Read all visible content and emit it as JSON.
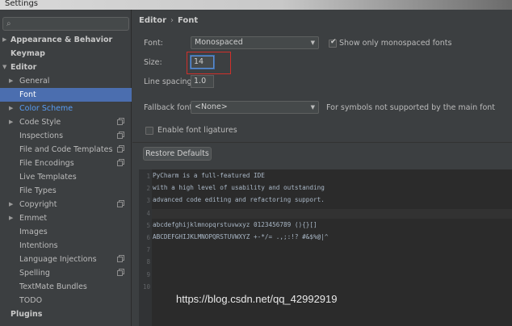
{
  "window": {
    "title": "Settings"
  },
  "sidebar": {
    "items": [
      {
        "label": "Appearance & Behavior",
        "level": 0,
        "arrow": "▶",
        "bold": true
      },
      {
        "label": "Keymap",
        "level": 0,
        "arrow": "",
        "bold": true
      },
      {
        "label": "Editor",
        "level": 0,
        "arrow": "▼",
        "bold": true
      },
      {
        "label": "General",
        "level": 1,
        "arrow": "▶"
      },
      {
        "label": "Font",
        "level": 1,
        "arrow": "",
        "selected": true
      },
      {
        "label": "Color Scheme",
        "level": 1,
        "arrow": "▶",
        "link": true
      },
      {
        "label": "Code Style",
        "level": 1,
        "arrow": "▶",
        "copy": true
      },
      {
        "label": "Inspections",
        "level": 1,
        "arrow": "",
        "copy": true
      },
      {
        "label": "File and Code Templates",
        "level": 1,
        "arrow": "",
        "copy": true
      },
      {
        "label": "File Encodings",
        "level": 1,
        "arrow": "",
        "copy": true
      },
      {
        "label": "Live Templates",
        "level": 1,
        "arrow": ""
      },
      {
        "label": "File Types",
        "level": 1,
        "arrow": ""
      },
      {
        "label": "Copyright",
        "level": 1,
        "arrow": "▶",
        "copy": true
      },
      {
        "label": "Emmet",
        "level": 1,
        "arrow": "▶"
      },
      {
        "label": "Images",
        "level": 1,
        "arrow": ""
      },
      {
        "label": "Intentions",
        "level": 1,
        "arrow": ""
      },
      {
        "label": "Language Injections",
        "level": 1,
        "arrow": "",
        "copy": true
      },
      {
        "label": "Spelling",
        "level": 1,
        "arrow": "",
        "copy": true
      },
      {
        "label": "TextMate Bundles",
        "level": 1,
        "arrow": ""
      },
      {
        "label": "TODO",
        "level": 1,
        "arrow": ""
      },
      {
        "label": "Plugins",
        "level": 0,
        "arrow": "",
        "bold": true
      }
    ]
  },
  "breadcrumb": {
    "parent": "Editor",
    "separator": "›",
    "current": "Font"
  },
  "font": {
    "font_label": "Font:",
    "font_value": "Monospaced",
    "show_mono_label": "Show only monospaced fonts",
    "show_mono_checked": true,
    "size_label": "Size:",
    "size_value": "14",
    "line_spacing_label": "Line spacing:",
    "line_spacing_value": "1.0",
    "fallback_label": "Fallback font:",
    "fallback_value": "<None>",
    "fallback_hint": "For symbols not supported by the main font",
    "ligatures_label": "Enable font ligatures",
    "ligatures_checked": false,
    "restore_label": "Restore Defaults"
  },
  "preview": {
    "lines": [
      {
        "n": "1",
        "text": "PyCharm is a full-featured IDE"
      },
      {
        "n": "2",
        "text": "with a high level of usability and outstanding"
      },
      {
        "n": "3",
        "text": "advanced code editing and refactoring support."
      },
      {
        "n": "4",
        "text": ""
      },
      {
        "n": "5",
        "text": "abcdefghijklmnopqrstuvwxyz 0123456789 (){}[]"
      },
      {
        "n": "6",
        "text": "ABCDEFGHIJKLMNOPQRSTUVWXYZ +-*/= .,;:!? #&$%@|^"
      },
      {
        "n": "7",
        "text": ""
      },
      {
        "n": "8",
        "text": ""
      },
      {
        "n": "9",
        "text": ""
      },
      {
        "n": "10",
        "text": ""
      }
    ]
  },
  "watermark": {
    "text": "https://blog.csdn.net/qq_42992919"
  },
  "icons": {
    "search": "magnifier-icon",
    "dropdown": "chevron-down-icon",
    "expand": "triangle-right-icon",
    "collapse": "triangle-down-icon",
    "project_scope": "copy-icon"
  },
  "colors": {
    "background": "#3c3f41",
    "selection": "#4b6eaf",
    "link": "#589df6",
    "editor_bg": "#2b2b2b",
    "highlight_box": "#d0302b"
  }
}
